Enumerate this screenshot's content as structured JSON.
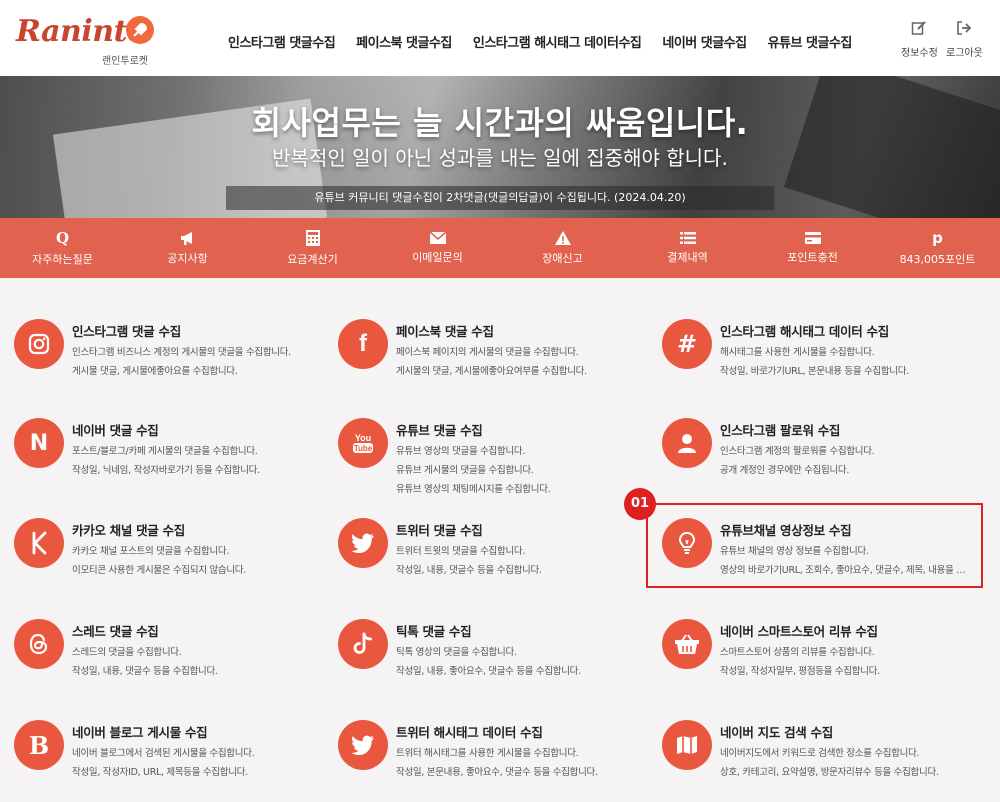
{
  "header": {
    "logo_text": "Raninto",
    "logo_sub": "랜인투로켓",
    "nav": [
      {
        "label": "인스타그램 댓글수집"
      },
      {
        "label": "페이스북 댓글수집"
      },
      {
        "label": "인스타그램 해시태그 데이터수집"
      },
      {
        "label": "네이버 댓글수집"
      },
      {
        "label": "유튜브 댓글수집"
      }
    ],
    "profile_edit": "정보수정",
    "logout": "로그아웃"
  },
  "hero": {
    "title": "회사업무는 늘 시간과의 싸움입니다.",
    "subtitle": "반복적인 일이 아닌 성과를 내는 일에 집중해야 합니다.",
    "notice": "유튜브 커뮤니티 댓글수집이 2차댓글(댓글의답글)이 수집됩니다. (2024.04.20)"
  },
  "quick_menu": [
    {
      "label": "자주하는질문",
      "icon": "q-icon"
    },
    {
      "label": "공지사항",
      "icon": "megaphone-icon"
    },
    {
      "label": "요금계산기",
      "icon": "calculator-icon"
    },
    {
      "label": "이메일문의",
      "icon": "envelope-icon"
    },
    {
      "label": "장애신고",
      "icon": "warning-icon"
    },
    {
      "label": "결제내역",
      "icon": "list-icon"
    },
    {
      "label": "포인트충전",
      "icon": "credit-card-icon"
    },
    {
      "label": "843,005포인트",
      "icon": "pinterest-p-icon"
    }
  ],
  "services": [
    {
      "title": "인스타그램 댓글 수집",
      "icon": "instagram-icon",
      "desc": [
        "인스타그램 비즈니스 계정의 게시물의 댓글을 수집합니다.",
        "게시물 댓글, 게시물에좋아요를 수집합니다."
      ]
    },
    {
      "title": "페이스북 댓글 수집",
      "icon": "facebook-icon",
      "desc": [
        "페이스북 페이지의 게시물의 댓글을 수집합니다.",
        "게시물의 댓글, 게시물에좋아요여부를 수집합니다."
      ]
    },
    {
      "title": "인스타그램 해시태그 데이터 수집",
      "icon": "hashtag-icon",
      "desc": [
        "해시태그를 사용한 게시물을 수집합니다.",
        "작성일, 바로가기URL, 본문내용 등을 수집합니다."
      ]
    },
    {
      "title": "네이버 댓글 수집",
      "icon": "naver-icon",
      "desc": [
        "포스트/블로그/카페 게시물의 댓글을 수집합니다.",
        "작성일, 닉네임, 작성자바로가기 등을 수집합니다."
      ]
    },
    {
      "title": "유튜브 댓글 수집",
      "icon": "youtube-icon",
      "desc": [
        "유튜브 영상의 댓글을 수집합니다.",
        "유튜브 게시물의 댓글을 수집합니다.",
        "유튜브 영상의 채팅메시지를 수집합니다."
      ]
    },
    {
      "title": "인스타그램 팔로워 수집",
      "icon": "user-icon",
      "desc": [
        "인스타그램 계정의 팔로워를 수집합니다.",
        "공개 계정인 경우에만 수집됩니다."
      ]
    },
    {
      "title": "카카오 채널 댓글 수집",
      "icon": "kakao-k-icon",
      "desc": [
        "카카오 채널 포스트의 댓글을 수집합니다.",
        "이모티콘 사용한 게시물은 수집되지 않습니다."
      ]
    },
    {
      "title": "트위터 댓글 수집",
      "icon": "twitter-icon",
      "desc": [
        "트위터 트윗의 댓글을 수집합니다.",
        "작성일, 내용, 댓글수 등을 수집합니다."
      ]
    },
    {
      "title": "유튜브채널 영상정보 수집",
      "icon": "lightbulb-icon",
      "desc": [
        "유튜브 채널의 영상 정보를 수집합니다.",
        "영상의 바로가기URL, 조회수, 좋아요수, 댓글수, 제목, 내용을 수집합니다."
      ]
    },
    {
      "title": "스레드 댓글 수집",
      "icon": "threads-icon",
      "desc": [
        "스레드의 댓글을 수집합니다.",
        "작성일, 내용, 댓글수 등을 수집합니다."
      ]
    },
    {
      "title": "틱톡 댓글 수집",
      "icon": "tiktok-icon",
      "desc": [
        "틱톡 영상의 댓글을 수집합니다.",
        "작성일, 내용, 좋아요수, 댓글수 등을 수집합니다."
      ]
    },
    {
      "title": "네이버 스마트스토어 리뷰 수집",
      "icon": "basket-icon",
      "desc": [
        "스마트스토어 상품의 리뷰를 수집합니다.",
        "작성일, 작성자일부, 평점등을 수집합니다."
      ]
    },
    {
      "title": "네이버 블로그 게시물 수집",
      "icon": "blog-b-icon",
      "desc": [
        "네이버 블로그에서 검색된 게시물을 수집합니다.",
        "작성일, 작성자ID, URL, 제목등을 수집합니다."
      ]
    },
    {
      "title": "트위터 해시태그 데이터 수집",
      "icon": "twitter-icon",
      "desc": [
        "트위터 해시태그를 사용한 게시물을 수집합니다.",
        "작성일, 본문내용, 좋아요수, 댓글수 등을 수집합니다."
      ]
    },
    {
      "title": "네이버 지도 검색 수집",
      "icon": "map-icon",
      "desc": [
        "네이버지도에서 키워드로 검색한 장소를 수집합니다.",
        "상호, 카테고리, 요약설명, 방문자리뷰수 등을 수집합니다."
      ]
    }
  ],
  "annotation": {
    "badge": "01"
  },
  "colors": {
    "accent": "#e9573f",
    "quick_bar": "#e0624f",
    "highlight": "#e02020"
  }
}
